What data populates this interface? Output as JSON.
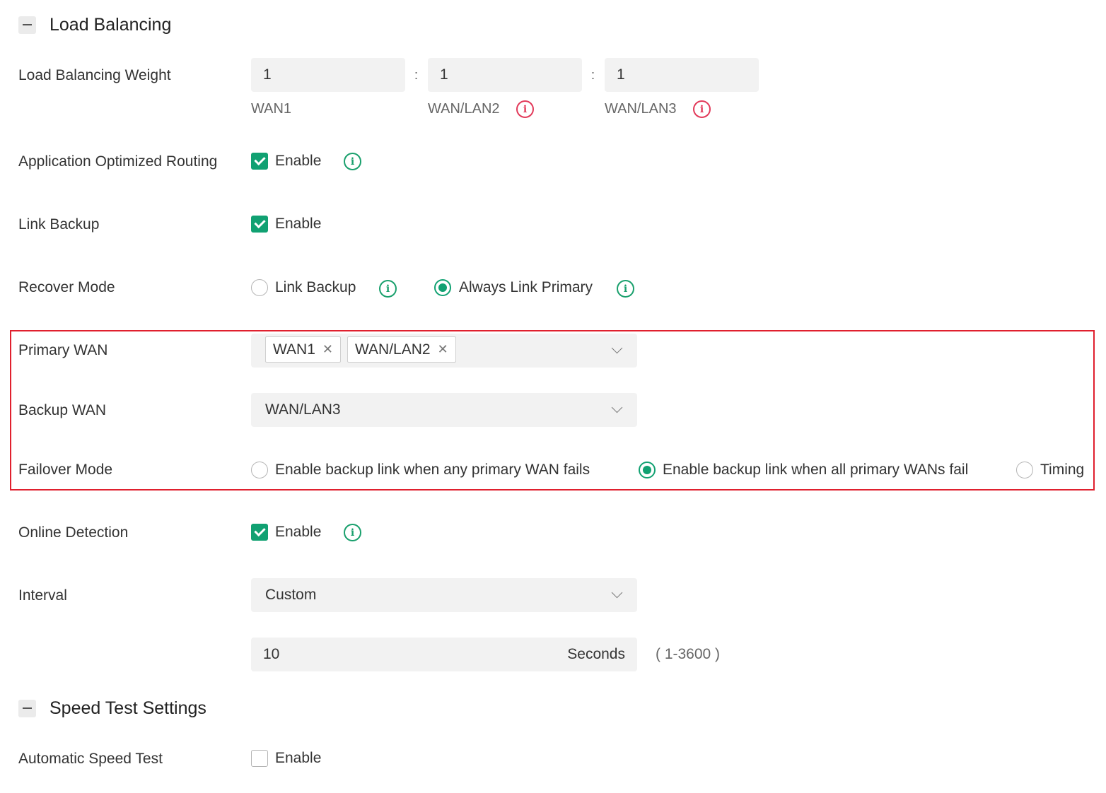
{
  "load_balancing": {
    "title": "Load Balancing",
    "weight": {
      "label": "Load Balancing Weight",
      "separator": ":",
      "values": [
        "1",
        "1",
        "1"
      ],
      "ports": [
        "WAN1",
        "WAN/LAN2",
        "WAN/LAN3"
      ]
    },
    "app_routing": {
      "label": "Application Optimized Routing",
      "option": "Enable",
      "checked": true
    },
    "link_backup": {
      "label": "Link Backup",
      "option": "Enable",
      "checked": true
    },
    "recover_mode": {
      "label": "Recover Mode",
      "options": [
        "Link Backup",
        "Always Link Primary"
      ],
      "selected": "Always Link Primary"
    },
    "primary_wan": {
      "label": "Primary WAN",
      "tags": [
        "WAN1",
        "WAN/LAN2"
      ]
    },
    "backup_wan": {
      "label": "Backup WAN",
      "value": "WAN/LAN3"
    },
    "failover_mode": {
      "label": "Failover Mode",
      "options": [
        "Enable backup link when any primary WAN fails",
        "Enable backup link when all primary WANs fail",
        "Timing"
      ],
      "selected": "Enable backup link when all primary WANs fail"
    },
    "online_detection": {
      "label": "Online Detection",
      "option": "Enable",
      "checked": true
    },
    "interval": {
      "label": "Interval",
      "value": "Custom",
      "seconds_value": "10",
      "seconds_unit": "Seconds",
      "range": "( 1-3600 )"
    }
  },
  "speed_test": {
    "title": "Speed Test Settings",
    "automatic": {
      "label": "Automatic Speed Test",
      "option": "Enable",
      "checked": false
    }
  },
  "icons": {
    "info": "info-icon",
    "close": "close-icon",
    "dropdown": "chevron-down-icon",
    "collapse": "collapse-icon"
  },
  "colors": {
    "accent": "#11a172",
    "warning": "#e23a5a",
    "highlight": "#e0202e"
  }
}
